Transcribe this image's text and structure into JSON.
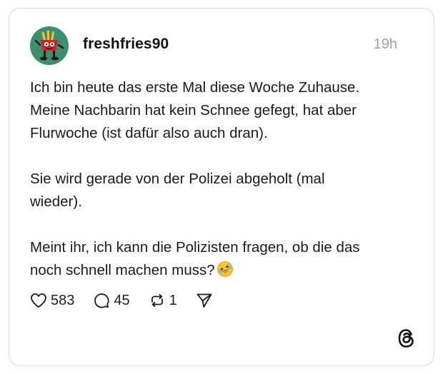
{
  "post": {
    "username": "freshfries90",
    "timestamp": "19h",
    "paragraphs": [
      [
        "Ich bin heute das erste Mal diese Woche Zuhause.",
        "Meine Nachbarin hat kein Schnee gefegt, hat aber",
        "Flurwoche (ist dafür also auch dran)."
      ],
      [
        "Sie wird gerade von der Polizei abgeholt (mal",
        "wieder)."
      ],
      [
        "Meint ihr, ich kann die Polizisten fragen, ob die das",
        "noch schnell machen muss?"
      ]
    ],
    "emoji": "rolling-on-floor-laughing-emoji"
  },
  "actions": {
    "like_count": "583",
    "reply_count": "45",
    "repost_count": "1"
  },
  "icons": {
    "like": "heart-icon",
    "reply": "speech-bubble-icon",
    "repost": "repost-icon",
    "share": "send-icon",
    "brand": "threads-logo-icon"
  },
  "colors": {
    "text": "#1a1a1a",
    "muted": "#a0a0a0",
    "border": "#d9d9d9",
    "emoji": "#f7c335"
  }
}
